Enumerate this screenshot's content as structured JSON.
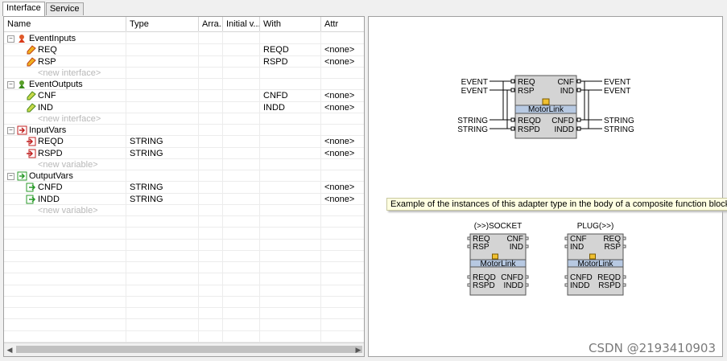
{
  "tabs": [
    {
      "label": "Interface",
      "active": true
    },
    {
      "label": "Service",
      "active": false
    }
  ],
  "table": {
    "columns": [
      "Name",
      "Type",
      "Arra...",
      "Initial v...",
      "With",
      "Attr"
    ],
    "groups": [
      {
        "label": "EventInputs",
        "icon": "event-inputs-icon",
        "rows": [
          {
            "name": "REQ",
            "type": "",
            "array": "",
            "initial": "",
            "with": "REQD",
            "attr": "<none>",
            "icon": "event-input-icon"
          },
          {
            "name": "RSP",
            "type": "",
            "array": "",
            "initial": "",
            "with": "RSPD",
            "attr": "<none>",
            "icon": "event-input-icon"
          }
        ],
        "new_label": "<new interface>"
      },
      {
        "label": "EventOutputs",
        "icon": "event-outputs-icon",
        "rows": [
          {
            "name": "CNF",
            "type": "",
            "array": "",
            "initial": "",
            "with": "CNFD",
            "attr": "<none>",
            "icon": "event-output-icon"
          },
          {
            "name": "IND",
            "type": "",
            "array": "",
            "initial": "",
            "with": "INDD",
            "attr": "<none>",
            "icon": "event-output-icon"
          }
        ],
        "new_label": "<new interface>"
      },
      {
        "label": "InputVars",
        "icon": "input-vars-icon",
        "rows": [
          {
            "name": "REQD",
            "type": "STRING",
            "array": "",
            "initial": "",
            "with": "",
            "attr": "<none>",
            "icon": "input-var-icon"
          },
          {
            "name": "RSPD",
            "type": "STRING",
            "array": "",
            "initial": "",
            "with": "",
            "attr": "<none>",
            "icon": "input-var-icon"
          }
        ],
        "new_label": "<new variable>"
      },
      {
        "label": "OutputVars",
        "icon": "output-vars-icon",
        "rows": [
          {
            "name": "CNFD",
            "type": "STRING",
            "array": "",
            "initial": "",
            "with": "",
            "attr": "<none>",
            "icon": "output-var-icon"
          },
          {
            "name": "INDD",
            "type": "STRING",
            "array": "",
            "initial": "",
            "with": "",
            "attr": "<none>",
            "icon": "output-var-icon"
          }
        ],
        "new_label": "<new variable>"
      }
    ]
  },
  "diagram": {
    "adapter": {
      "name": "MotorLink",
      "left_events": [
        "EVENT",
        "EVENT"
      ],
      "right_events": [
        "EVENT",
        "EVENT"
      ],
      "left_vars": [
        "STRING",
        "STRING"
      ],
      "right_vars": [
        "STRING",
        "STRING"
      ],
      "event_inputs": [
        "REQ",
        "RSP"
      ],
      "event_outputs": [
        "CNF",
        "IND"
      ],
      "data_inputs": [
        "REQD",
        "RSPD"
      ],
      "data_outputs": [
        "CNFD",
        "INDD"
      ]
    },
    "tooltip": "Example of the instances of this adapter type in the body of a composite function block:",
    "socket": {
      "title": "(>>)SOCKET",
      "name": "MotorLink",
      "ev_left": [
        "REQ",
        "RSP"
      ],
      "ev_right": [
        "CNF",
        "IND"
      ],
      "var_left": [
        "REQD",
        "RSPD"
      ],
      "var_right": [
        "CNFD",
        "INDD"
      ]
    },
    "plug": {
      "title": "PLUG(>>)",
      "name": "MotorLink",
      "ev_left": [
        "CNF",
        "IND"
      ],
      "ev_right": [
        "REQ",
        "RSP"
      ],
      "var_left": [
        "CNFD",
        "INDD"
      ],
      "var_right": [
        "REQD",
        "RSPD"
      ]
    }
  },
  "colors": {
    "block_fill": "#d4d4d4",
    "header_fill": "#b7c9e2",
    "tooltip_bg": "#ffffe1"
  },
  "watermark": "CSDN @2193410903"
}
